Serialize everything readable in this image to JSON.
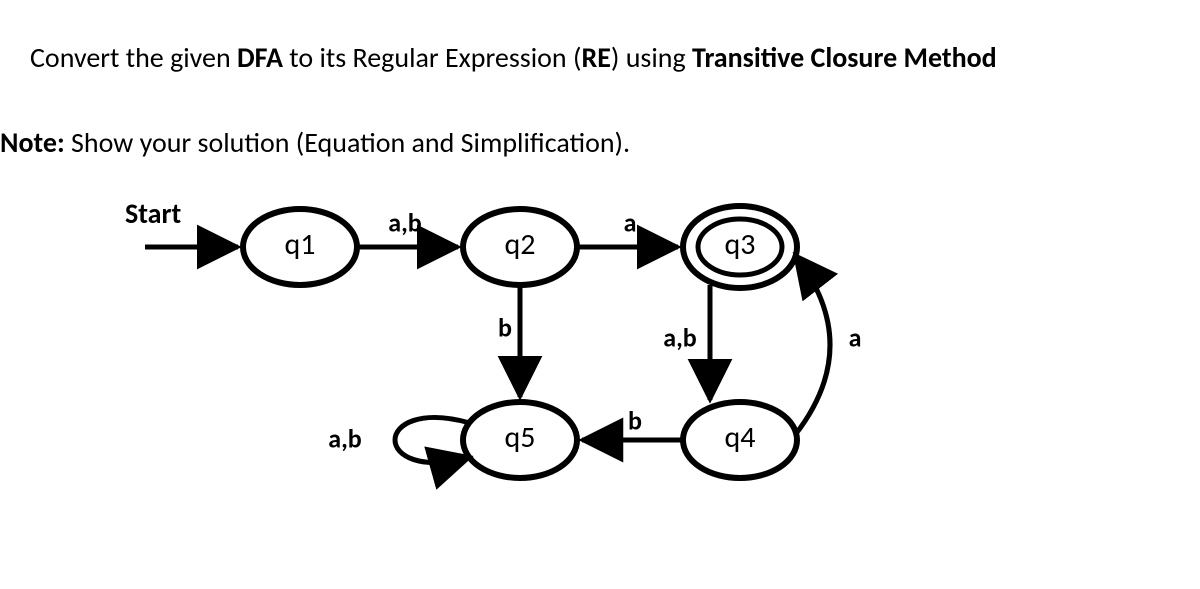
{
  "title": {
    "prefix": "Convert the given ",
    "dfa": "DFA",
    "mid": " to its Regular Expression (",
    "re": "RE",
    "mid2": ") using ",
    "method": "Transitive Closure Method"
  },
  "note": {
    "label": "Note:",
    "text": " Show your solution (Equation and Simplification)."
  },
  "dfa_diagram": {
    "start_label": "Start",
    "states": {
      "q1": "q1",
      "q2": "q2",
      "q3": "q3",
      "q4": "q4",
      "q5": "q5"
    },
    "transitions": {
      "q1_q2": "a,b",
      "q2_q3": "a",
      "q2_q5": "b",
      "q3_q4": "a,b",
      "q4_q3": "a",
      "q4_q5": "b",
      "q5_q5": "a,b"
    },
    "accepting": [
      "q3"
    ]
  },
  "chart_data": {
    "type": "state_diagram",
    "start_state": "q1",
    "states": [
      "q1",
      "q2",
      "q3",
      "q4",
      "q5"
    ],
    "accepting_states": [
      "q3"
    ],
    "transitions": [
      {
        "from": "q1",
        "to": "q2",
        "label": "a,b"
      },
      {
        "from": "q2",
        "to": "q3",
        "label": "a"
      },
      {
        "from": "q2",
        "to": "q5",
        "label": "b"
      },
      {
        "from": "q3",
        "to": "q4",
        "label": "a,b"
      },
      {
        "from": "q4",
        "to": "q3",
        "label": "a"
      },
      {
        "from": "q4",
        "to": "q5",
        "label": "b"
      },
      {
        "from": "q5",
        "to": "q5",
        "label": "a,b"
      }
    ]
  }
}
